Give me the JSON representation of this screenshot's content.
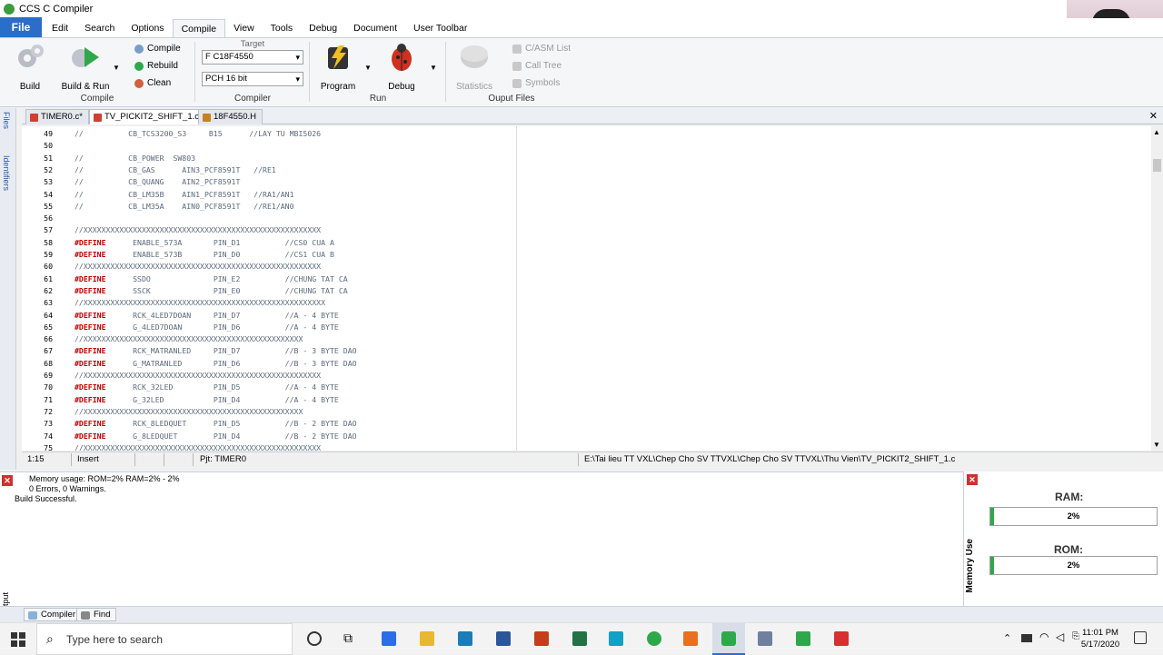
{
  "window": {
    "title": "CCS C Compiler"
  },
  "menu": [
    "File",
    "Edit",
    "Search",
    "Options",
    "Compile",
    "View",
    "Tools",
    "Debug",
    "Document",
    "User Toolbar"
  ],
  "ribbon": {
    "build": "Build",
    "build_run": "Build & Run",
    "compile": "Compile",
    "rebuild": "Rebuild",
    "clean": "Clean",
    "group_compile": "Compile",
    "target_label": "Target",
    "target_value": "F C18F4550",
    "compiler_value": "PCH 16 bit",
    "group_compiler": "Compiler",
    "program": "Program",
    "debug": "Debug",
    "group_run": "Run",
    "statistics": "Statistics",
    "casm_list": "C/ASM List",
    "call_tree": "Call Tree",
    "symbols": "Symbols",
    "group_output": "Ouput Files"
  },
  "sidebar": {
    "files": "Files",
    "identifiers": "Identifiers",
    "output": "Output"
  },
  "tabs": [
    "TIMER0.c*",
    "TV_PICKIT2_SHIFT_1.c",
    "18F4550.H"
  ],
  "code_lines": [
    {
      "n": "49",
      "kw": "",
      "text": "//          CB_TCS3200_S3     B15      //LAY TU MBI5026"
    },
    {
      "n": "50",
      "kw": "",
      "text": ""
    },
    {
      "n": "51",
      "kw": "",
      "text": "//          CB_POWER  SW803"
    },
    {
      "n": "52",
      "kw": "",
      "text": "//          CB_GAS      AIN3_PCF8591T   //RE1"
    },
    {
      "n": "53",
      "kw": "",
      "text": "//          CB_QUANG    AIN2_PCF8591T"
    },
    {
      "n": "54",
      "kw": "",
      "text": "//          CB_LM35B    AIN1_PCF8591T   //RA1/AN1"
    },
    {
      "n": "55",
      "kw": "",
      "text": "//          CB_LM35A    AIN0_PCF8591T   //RE1/AN0"
    },
    {
      "n": "56",
      "kw": "",
      "text": ""
    },
    {
      "n": "57",
      "kw": "",
      "text": "//XXXXXXXXXXXXXXXXXXXXXXXXXXXXXXXXXXXXXXXXXXXXXXXXXXXXX"
    },
    {
      "n": "58",
      "kw": "#DEFINE",
      "text": "      ENABLE_573A       PIN_D1          //CS0 CUA A"
    },
    {
      "n": "59",
      "kw": "#DEFINE",
      "text": "      ENABLE_573B       PIN_D0          //CS1 CUA B"
    },
    {
      "n": "60",
      "kw": "",
      "text": "//XXXXXXXXXXXXXXXXXXXXXXXXXXXXXXXXXXXXXXXXXXXXXXXXXXXXX"
    },
    {
      "n": "61",
      "kw": "#DEFINE",
      "text": "      SSDO              PIN_E2          //CHUNG TAT CA"
    },
    {
      "n": "62",
      "kw": "#DEFINE",
      "text": "      SSCK              PIN_E0          //CHUNG TAT CA"
    },
    {
      "n": "63",
      "kw": "",
      "text": "//XXXXXXXXXXXXXXXXXXXXXXXXXXXXXXXXXXXXXXXXXXXXXXXXXXXXXX"
    },
    {
      "n": "64",
      "kw": "#DEFINE",
      "text": "      RCK_4LED7DOAN     PIN_D7          //A - 4 BYTE"
    },
    {
      "n": "65",
      "kw": "#DEFINE",
      "text": "      G_4LED7DOAN       PIN_D6          //A - 4 BYTE"
    },
    {
      "n": "66",
      "kw": "",
      "text": "//XXXXXXXXXXXXXXXXXXXXXXXXXXXXXXXXXXXXXXXXXXXXXXXXX"
    },
    {
      "n": "67",
      "kw": "#DEFINE",
      "text": "      RCK_MATRANLED     PIN_D7          //B - 3 BYTE DAO"
    },
    {
      "n": "68",
      "kw": "#DEFINE",
      "text": "      G_MATRANLED       PIN_D6          //B - 3 BYTE DAO"
    },
    {
      "n": "69",
      "kw": "",
      "text": "//XXXXXXXXXXXXXXXXXXXXXXXXXXXXXXXXXXXXXXXXXXXXXXXXXXXXX"
    },
    {
      "n": "70",
      "kw": "#DEFINE",
      "text": "      RCK_32LED         PIN_D5          //A - 4 BYTE"
    },
    {
      "n": "71",
      "kw": "#DEFINE",
      "text": "      G_32LED           PIN_D4          //A - 4 BYTE"
    },
    {
      "n": "72",
      "kw": "",
      "text": "//XXXXXXXXXXXXXXXXXXXXXXXXXXXXXXXXXXXXXXXXXXXXXXXXX"
    },
    {
      "n": "73",
      "kw": "#DEFINE",
      "text": "      RCK_8LEDQUET      PIN_D5          //B - 2 BYTE DAO"
    },
    {
      "n": "74",
      "kw": "#DEFINE",
      "text": "      G_8LEDQUET        PIN_D4          //B - 2 BYTE DAO"
    },
    {
      "n": "75",
      "kw": "",
      "text": "//XXXXXXXXXXXXXXXXXXXXXXXXXXXXXXXXXXXXXXXXXXXXXXXXXXXXX"
    }
  ],
  "status": {
    "position": "1:15",
    "mode": "Insert",
    "project": "Pjt: TIMER0",
    "path": "E:\\Tai lieu TT VXL\\Chep Cho SV TTVXL\\Chep Cho SV TTVXL\\Thu Vien\\TV_PICKIT2_SHIFT_1.c"
  },
  "output": {
    "line1": "Memory usage:   ROM=2%      RAM=2% - 2%",
    "line2": "0 Errors,  0 Warnings.",
    "line3": "Build Successful."
  },
  "output_tabs": [
    "Compiler",
    "Find"
  ],
  "memory": {
    "title": "Memory Use",
    "ram_label": "RAM:",
    "ram_value": "2%",
    "ram_fraction": 0.02,
    "rom_label": "ROM:",
    "rom_value": "2%",
    "rom_fraction": 0.02
  },
  "taskbar": {
    "search_placeholder": "Type here to search",
    "time": "11:01 PM",
    "date": "5/17/2020"
  },
  "colors": {
    "accent": "#2b6ec7",
    "keyword": "#c00000",
    "memory_fill": "#2da84a"
  }
}
